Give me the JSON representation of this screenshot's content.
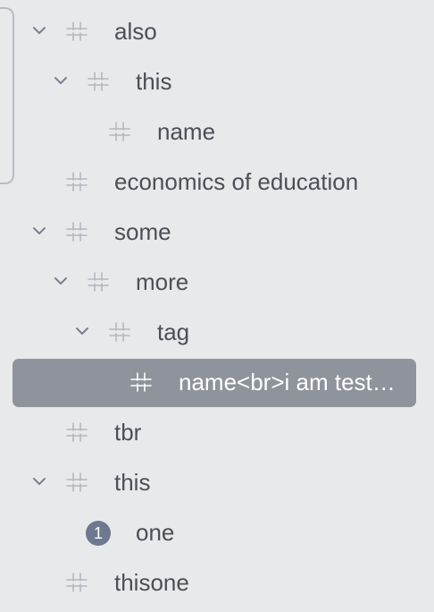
{
  "tree": {
    "rows": [
      {
        "label": "also",
        "level": 0,
        "expandable": true,
        "icon": "tag-icon"
      },
      {
        "label": "this",
        "level": 1,
        "expandable": true,
        "icon": "tag-icon"
      },
      {
        "label": "name",
        "level": 2,
        "expandable": false,
        "icon": "tag-icon"
      },
      {
        "label": "economics of education",
        "level": 0,
        "expandable": false,
        "icon": "tag-icon"
      },
      {
        "label": "some",
        "level": 0,
        "expandable": true,
        "icon": "tag-icon"
      },
      {
        "label": "more",
        "level": 1,
        "expandable": true,
        "icon": "tag-icon"
      },
      {
        "label": "tag",
        "level": 2,
        "expandable": true,
        "icon": "tag-icon"
      },
      {
        "label": "name<br>i am test…",
        "level": 3,
        "expandable": false,
        "icon": "tag-icon",
        "selected": true
      },
      {
        "label": "tbr",
        "level": 0,
        "expandable": false,
        "icon": "tag-icon"
      },
      {
        "label": "this",
        "level": 0,
        "expandable": true,
        "icon": "tag-icon"
      },
      {
        "label": "one",
        "level": 1,
        "expandable": false,
        "icon": "count-badge",
        "badge": "1"
      },
      {
        "label": "thisone",
        "level": 0,
        "expandable": false,
        "icon": "tag-icon"
      }
    ]
  },
  "colors": {
    "background": "#e8e9eb",
    "text": "#4b4f57",
    "icon": "#b3b7be",
    "chevron": "#7a818d",
    "selected_background": "#8e939c",
    "selected_text": "#ffffff",
    "badge": "#6e7891"
  }
}
